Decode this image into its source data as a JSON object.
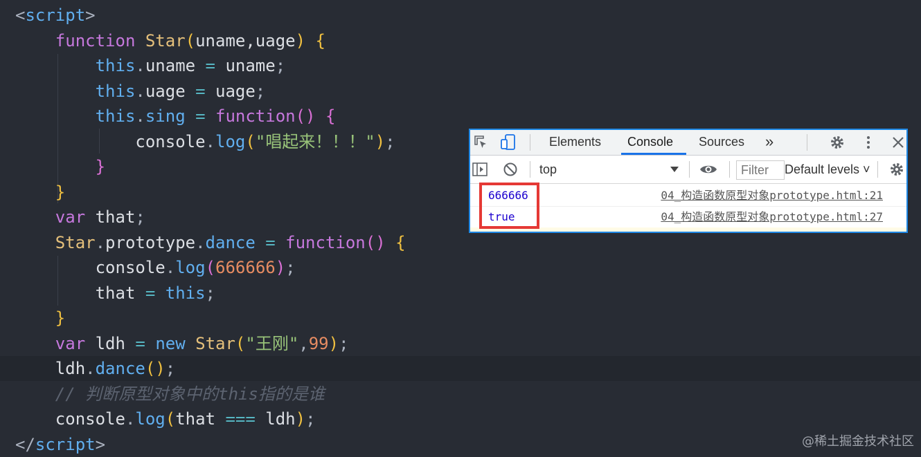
{
  "code_lines": [
    [
      {
        "t": "<",
        "c": "punc"
      },
      {
        "t": "script",
        "c": "tag"
      },
      {
        "t": ">",
        "c": "punc"
      }
    ],
    [
      {
        "t": "    ",
        "c": "plain"
      },
      {
        "t": "function",
        "c": "keyword"
      },
      {
        "t": " ",
        "c": "plain"
      },
      {
        "t": "Star",
        "c": "func"
      },
      {
        "t": "(",
        "c": "b1"
      },
      {
        "t": "uname,uage",
        "c": "plain"
      },
      {
        "t": ")",
        "c": "b1"
      },
      {
        "t": " ",
        "c": "plain"
      },
      {
        "t": "{",
        "c": "b1"
      }
    ],
    [
      {
        "t": "        ",
        "c": "plain"
      },
      {
        "t": "this",
        "c": "this"
      },
      {
        "t": ".",
        "c": "punc"
      },
      {
        "t": "uname",
        "c": "plain"
      },
      {
        "t": " = ",
        "c": "op"
      },
      {
        "t": "uname",
        "c": "plain"
      },
      {
        "t": ";",
        "c": "punc"
      }
    ],
    [
      {
        "t": "        ",
        "c": "plain"
      },
      {
        "t": "this",
        "c": "this"
      },
      {
        "t": ".",
        "c": "punc"
      },
      {
        "t": "uage",
        "c": "plain"
      },
      {
        "t": " = ",
        "c": "op"
      },
      {
        "t": "uage",
        "c": "plain"
      },
      {
        "t": ";",
        "c": "punc"
      }
    ],
    [
      {
        "t": "        ",
        "c": "plain"
      },
      {
        "t": "this",
        "c": "this"
      },
      {
        "t": ".",
        "c": "punc"
      },
      {
        "t": "sing",
        "c": "prop"
      },
      {
        "t": " = ",
        "c": "op"
      },
      {
        "t": "function",
        "c": "keyword"
      },
      {
        "t": "()",
        "c": "b2"
      },
      {
        "t": " ",
        "c": "plain"
      },
      {
        "t": "{",
        "c": "b2"
      }
    ],
    [
      {
        "t": "            ",
        "c": "plain"
      },
      {
        "t": "console",
        "c": "plain"
      },
      {
        "t": ".",
        "c": "punc"
      },
      {
        "t": "log",
        "c": "method"
      },
      {
        "t": "(",
        "c": "b1"
      },
      {
        "t": "\"唱起来！！！\"",
        "c": "string"
      },
      {
        "t": ")",
        "c": "b1"
      },
      {
        "t": ";",
        "c": "punc"
      }
    ],
    [
      {
        "t": "        ",
        "c": "plain"
      },
      {
        "t": "}",
        "c": "b2"
      }
    ],
    [
      {
        "t": "    ",
        "c": "plain"
      },
      {
        "t": "}",
        "c": "b1"
      }
    ],
    [
      {
        "t": "    ",
        "c": "plain"
      },
      {
        "t": "var",
        "c": "keyword"
      },
      {
        "t": " that",
        "c": "plain"
      },
      {
        "t": ";",
        "c": "punc"
      }
    ],
    [
      {
        "t": "    ",
        "c": "plain"
      },
      {
        "t": "Star",
        "c": "func"
      },
      {
        "t": ".",
        "c": "punc"
      },
      {
        "t": "prototype",
        "c": "plain"
      },
      {
        "t": ".",
        "c": "punc"
      },
      {
        "t": "dance",
        "c": "prop"
      },
      {
        "t": " = ",
        "c": "op"
      },
      {
        "t": "function",
        "c": "keyword"
      },
      {
        "t": "()",
        "c": "b2"
      },
      {
        "t": " ",
        "c": "plain"
      },
      {
        "t": "{",
        "c": "b1"
      }
    ],
    [
      {
        "t": "        ",
        "c": "plain"
      },
      {
        "t": "console",
        "c": "plain"
      },
      {
        "t": ".",
        "c": "punc"
      },
      {
        "t": "log",
        "c": "method"
      },
      {
        "t": "(",
        "c": "b2"
      },
      {
        "t": "666666",
        "c": "number"
      },
      {
        "t": ")",
        "c": "b2"
      },
      {
        "t": ";",
        "c": "punc"
      }
    ],
    [
      {
        "t": "        ",
        "c": "plain"
      },
      {
        "t": "that",
        "c": "plain"
      },
      {
        "t": " = ",
        "c": "op"
      },
      {
        "t": "this",
        "c": "this"
      },
      {
        "t": ";",
        "c": "punc"
      }
    ],
    [
      {
        "t": "    ",
        "c": "plain"
      },
      {
        "t": "}",
        "c": "b1"
      }
    ],
    [
      {
        "t": "    ",
        "c": "plain"
      },
      {
        "t": "var",
        "c": "keyword"
      },
      {
        "t": " ldh",
        "c": "plain"
      },
      {
        "t": " = ",
        "c": "op"
      },
      {
        "t": "new",
        "c": "this"
      },
      {
        "t": " ",
        "c": "plain"
      },
      {
        "t": "Star",
        "c": "func"
      },
      {
        "t": "(",
        "c": "b1"
      },
      {
        "t": "\"王刚\"",
        "c": "string"
      },
      {
        "t": ",",
        "c": "punc"
      },
      {
        "t": "99",
        "c": "number"
      },
      {
        "t": ")",
        "c": "b1"
      },
      {
        "t": ";",
        "c": "punc"
      }
    ],
    [
      {
        "t": "    ",
        "c": "plain"
      },
      {
        "t": "ldh",
        "c": "plain"
      },
      {
        "t": ".",
        "c": "punc"
      },
      {
        "t": "dance",
        "c": "method"
      },
      {
        "t": "()",
        "c": "b1"
      },
      {
        "t": ";",
        "c": "punc"
      }
    ],
    [
      {
        "t": "    ",
        "c": "plain"
      },
      {
        "t": "// 判断原型对象中的this指的是谁",
        "c": "comment"
      }
    ],
    [
      {
        "t": "    ",
        "c": "plain"
      },
      {
        "t": "console",
        "c": "plain"
      },
      {
        "t": ".",
        "c": "punc"
      },
      {
        "t": "log",
        "c": "method"
      },
      {
        "t": "(",
        "c": "b1"
      },
      {
        "t": "that",
        "c": "plain"
      },
      {
        "t": " === ",
        "c": "op"
      },
      {
        "t": "ldh",
        "c": "plain"
      },
      {
        "t": ")",
        "c": "b1"
      },
      {
        "t": ";",
        "c": "punc"
      }
    ],
    [
      {
        "t": "</",
        "c": "punc"
      },
      {
        "t": "script",
        "c": "tag"
      },
      {
        "t": ">",
        "c": "punc"
      }
    ]
  ],
  "current_line_index": 14,
  "devtools": {
    "tabs": {
      "elements": "Elements",
      "console": "Console",
      "sources": "Sources",
      "more": "»"
    },
    "active_tab": "Console",
    "toolbar": {
      "context": "top",
      "filter_placeholder": "Filter",
      "levels": "Default levels ˅"
    },
    "console_rows": [
      {
        "value": "666666",
        "source": "04_构造函数原型对象prototype.html:21"
      },
      {
        "value": "true",
        "source": "04_构造函数原型对象prototype.html:27"
      }
    ],
    "colors": {
      "accent": "#1a73e8",
      "frame": "#1e88e5",
      "highlight": "#e53935"
    }
  },
  "watermark": "@稀土掘金技术社区"
}
